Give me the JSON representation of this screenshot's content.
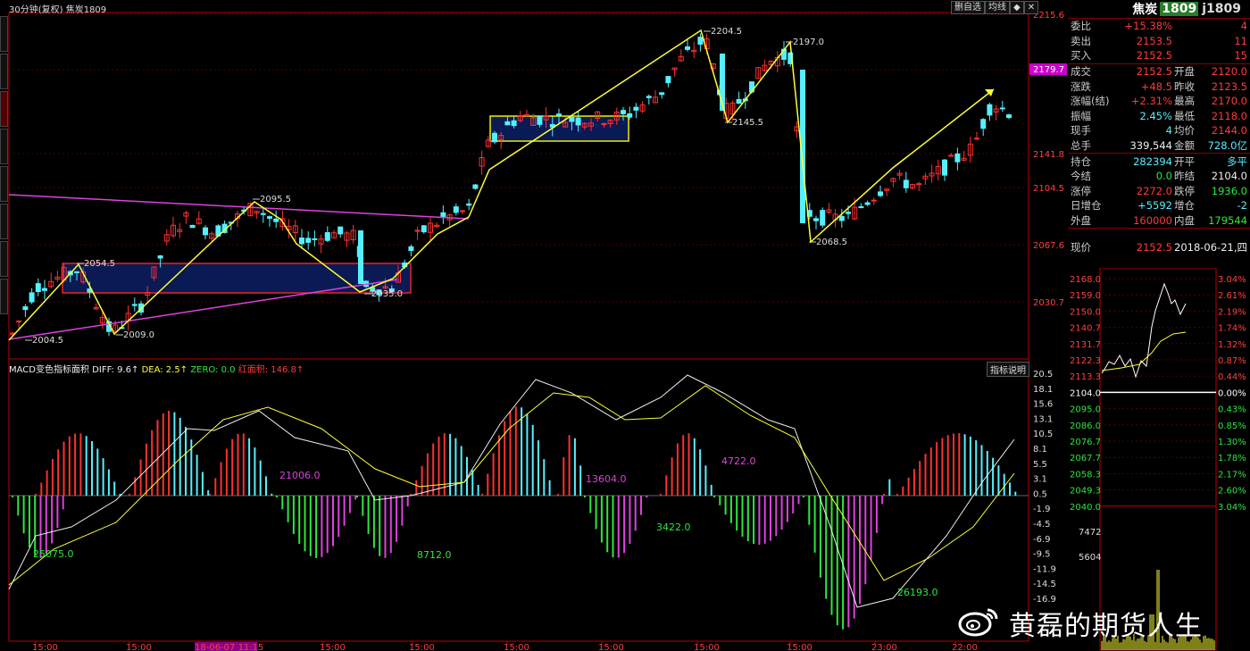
{
  "header": {
    "title": "30分钟(复权)  焦炭1809",
    "buttons": [
      "删自选",
      "均线",
      "◆",
      "✕"
    ]
  },
  "main_chart": {
    "price_axis": [
      "2215.6",
      "2179.7",
      "2141.8",
      "2104.5",
      "2067.6",
      "2030.7"
    ],
    "current_price_tag": "2179.7",
    "annotations": [
      "2204.5",
      "2197.0",
      "2145.5",
      "2095.5",
      "2054.5",
      "2009.0",
      "2004.5",
      "2035.0",
      "2068.5"
    ]
  },
  "macd": {
    "title_prefix": "MACD变色指标面积",
    "diff": "DIFF: 9.6↑",
    "dea": "DEA: 2.5↑",
    "zero": "ZERO: 0.0",
    "area": "红面积: 146.8↑",
    "button": "指标说明",
    "axis": [
      "20.5",
      "18.1",
      "15.6",
      "13.1",
      "10.5",
      "8.1",
      "5.5",
      "3.1",
      "0.5",
      "-1.9",
      "-4.5",
      "-6.9",
      "-9.5",
      "-11.9",
      "-14.5",
      "-16.9"
    ],
    "areas": [
      "21006.0",
      "13604.0",
      "4722.0",
      "25075.0",
      "8712.0",
      "3422.0",
      "26193.0"
    ]
  },
  "time_axis": [
    "15:00",
    "15:00",
    "18-06-07 11:15",
    "15:00",
    "15:00",
    "15:00",
    "15:00",
    "15:00",
    "15:00",
    "23:00",
    "22:00"
  ],
  "quote": {
    "name": "焦炭",
    "code1": "1809",
    "code2": "j1809",
    "rows_a": [
      {
        "l": "委比",
        "v": "+15.38%",
        "c": "red",
        "v2": "4",
        "c2": "red"
      },
      {
        "l": "卖出",
        "v": "2153.5",
        "c": "red",
        "v2": "11",
        "c2": "red"
      },
      {
        "l": "买入",
        "v": "2152.5",
        "c": "red",
        "v2": "15",
        "c2": "red"
      }
    ],
    "rows_b": [
      {
        "l": "成交",
        "v": "2152.5",
        "c": "red",
        "l2": "开盘",
        "v2": "2120.0",
        "c2": "red"
      },
      {
        "l": "涨跌",
        "v": "+48.5",
        "c": "red",
        "l2": "昨收",
        "v2": "2123.5",
        "c2": "red"
      },
      {
        "l": "涨幅(结)",
        "v": "+2.31%",
        "c": "red",
        "l2": "最高",
        "v2": "2170.0",
        "c2": "red"
      },
      {
        "l": "振幅",
        "v": "2.45%",
        "c": "cyan",
        "l2": "最低",
        "v2": "2118.0",
        "c2": "red"
      },
      {
        "l": "现手",
        "v": "4",
        "c": "cyan",
        "l2": "均价",
        "v2": "2144.0",
        "c2": "red"
      },
      {
        "l": "总手",
        "v": "339,544",
        "c": "white",
        "l2": "金额",
        "v2": "728.0亿",
        "c2": "cyan"
      }
    ],
    "rows_c": [
      {
        "l": "持仓",
        "v": "282394",
        "c": "cyan",
        "l2": "开平",
        "v2": "多平",
        "c2": "cyan"
      },
      {
        "l": "今结",
        "v": "0.0",
        "c": "green",
        "l2": "昨结",
        "v2": "2104.0",
        "c2": "white"
      },
      {
        "l": "涨停",
        "v": "2272.0",
        "c": "red",
        "l2": "跌停",
        "v2": "1936.0",
        "c2": "green"
      },
      {
        "l": "日增仓",
        "v": "+5592",
        "c": "cyan",
        "l2": "增仓",
        "v2": "-2",
        "c2": "cyan"
      },
      {
        "l": "外盘",
        "v": "160000",
        "c": "red",
        "l2": "内盘",
        "v2": "179544",
        "c2": "green"
      }
    ],
    "now_label": "现价",
    "now_price": "2152.5",
    "now_date": "2018-06-21,四"
  },
  "mini_chart": {
    "left_axis": [
      "2168.0",
      "2159.0",
      "2150.0",
      "2140.7",
      "2131.7",
      "2122.3",
      "2113.3",
      "2104.0",
      "2095.0",
      "2086.0",
      "2076.7",
      "2067.7",
      "2058.3",
      "2049.3",
      "2040.0"
    ],
    "right_axis": [
      "3.04%",
      "2.61%",
      "2.19%",
      "1.74%",
      "1.32%",
      "0.87%",
      "0.44%",
      "0.00%",
      "0.43%",
      "0.85%",
      "1.30%",
      "1.78%",
      "2.17%",
      "2.60%",
      "3.04%"
    ],
    "volume_axis": [
      "7472",
      "5604"
    ]
  },
  "watermark": "黄磊的期货人生"
}
